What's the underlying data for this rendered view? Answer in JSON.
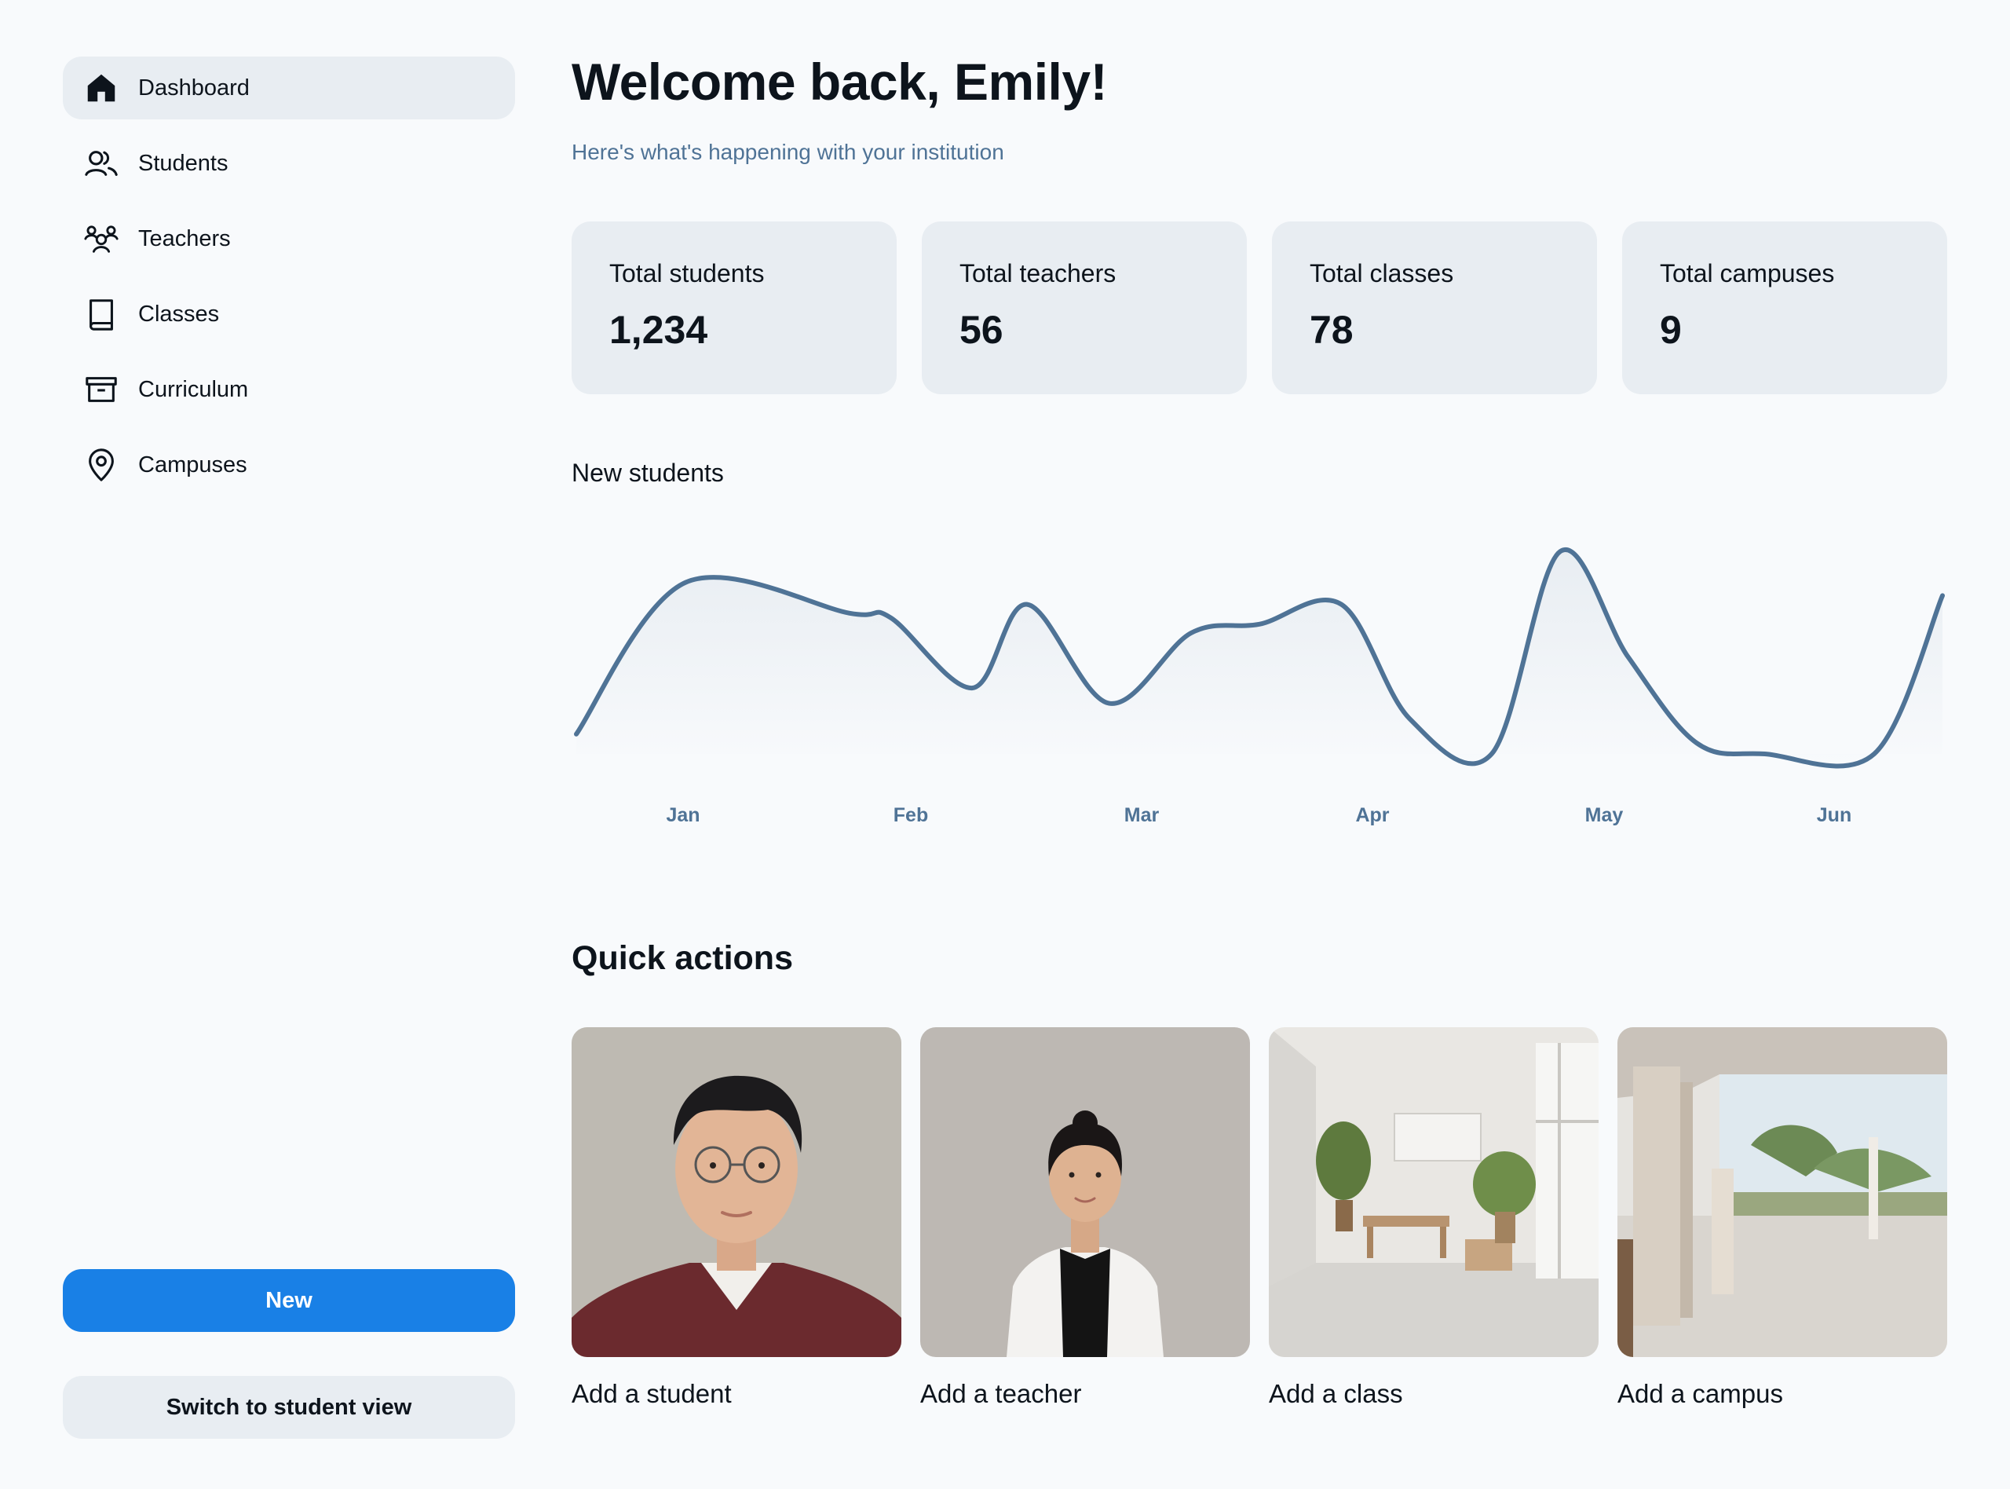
{
  "sidebar": {
    "items": [
      {
        "label": "Dashboard",
        "icon": "house-icon",
        "active": true
      },
      {
        "label": "Students",
        "icon": "users-icon"
      },
      {
        "label": "Teachers",
        "icon": "users-three-icon"
      },
      {
        "label": "Classes",
        "icon": "book-icon"
      },
      {
        "label": "Curriculum",
        "icon": "archive-icon"
      },
      {
        "label": "Campuses",
        "icon": "map-pin-icon"
      }
    ],
    "new_button": "New",
    "switch_button": "Switch to student view"
  },
  "header": {
    "title": "Welcome back, Emily!",
    "subtitle": "Here's what's happening with your institution"
  },
  "stats": [
    {
      "label": "Total students",
      "value": "1,234"
    },
    {
      "label": "Total teachers",
      "value": "56"
    },
    {
      "label": "Total classes",
      "value": "78"
    },
    {
      "label": "Total campuses",
      "value": "9"
    }
  ],
  "chart": {
    "title": "New students",
    "months": [
      "Jan",
      "Feb",
      "Mar",
      "Apr",
      "May",
      "Jun"
    ]
  },
  "chart_data": {
    "type": "area",
    "title": "New students",
    "categories": [
      "Jan",
      "Feb",
      "Mar",
      "Apr",
      "May",
      "Jun"
    ],
    "x": [
      0,
      0.08,
      0.2,
      0.23,
      0.29,
      0.33,
      0.39,
      0.45,
      0.5,
      0.56,
      0.61,
      0.67,
      0.72,
      0.77,
      0.82,
      0.87,
      0.95,
      1.0
    ],
    "values": [
      9,
      78,
      64,
      62,
      30,
      68,
      23,
      55,
      59,
      68,
      16,
      0,
      92,
      44,
      5,
      0,
      0,
      72
    ],
    "accent_color": "#4f7396"
  },
  "quick_actions": {
    "title": "Quick actions",
    "items": [
      {
        "label": "Add a student",
        "image": "student-photo"
      },
      {
        "label": "Add a teacher",
        "image": "teacher-photo"
      },
      {
        "label": "Add a class",
        "image": "classroom-photo"
      },
      {
        "label": "Add a campus",
        "image": "campus-photo"
      }
    ]
  },
  "colors": {
    "background": "#f8fafc",
    "card": "#e8edf2",
    "primary": "#1980e6",
    "muted_text": "#4f7396",
    "text": "#0d141c"
  }
}
